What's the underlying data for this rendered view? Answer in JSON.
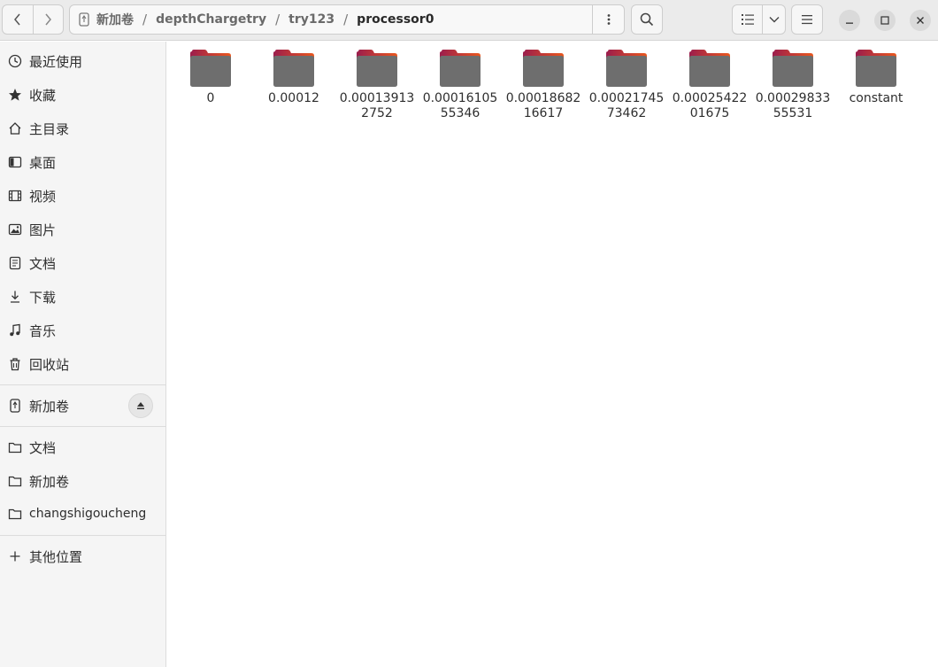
{
  "header": {
    "nav": {
      "back_icon": "chevron-left-icon",
      "forward_icon": "chevron-right-icon"
    },
    "path": [
      {
        "label": "新加卷",
        "icon": "usb-drive-icon"
      },
      {
        "label": "depthChargetry"
      },
      {
        "label": "try123"
      },
      {
        "label": "processor0",
        "current": true
      }
    ],
    "separator": "/",
    "icons": {
      "path_menu": "vertical-dots-icon",
      "search": "search-icon",
      "list_view": "list-view-icon",
      "view_options": "chevron-down-icon",
      "main_menu": "hamburger-menu-icon",
      "minimize": "minimize-icon",
      "maximize": "maximize-icon",
      "close": "close-icon"
    }
  },
  "sidebar": {
    "places": [
      {
        "label": "最近使用",
        "icon": "clock-icon"
      },
      {
        "label": "收藏",
        "icon": "star-icon"
      },
      {
        "label": "主目录",
        "icon": "home-icon"
      },
      {
        "label": "桌面",
        "icon": "desktop-icon"
      },
      {
        "label": "视频",
        "icon": "video-icon"
      },
      {
        "label": "图片",
        "icon": "image-icon"
      },
      {
        "label": "文档",
        "icon": "document-icon"
      },
      {
        "label": "下载",
        "icon": "download-icon"
      },
      {
        "label": "音乐",
        "icon": "music-icon"
      },
      {
        "label": "回收站",
        "icon": "trash-icon"
      }
    ],
    "devices": [
      {
        "label": "新加卷",
        "icon": "usb-drive-icon",
        "action_icon": "eject-icon"
      }
    ],
    "bookmarks": [
      {
        "label": "文档",
        "icon": "folder-icon"
      },
      {
        "label": "新加卷",
        "icon": "folder-icon"
      },
      {
        "label": "changshigoucheng",
        "icon": "folder-icon"
      }
    ],
    "other": {
      "label": "其他位置",
      "icon": "plus-icon"
    }
  },
  "files": [
    {
      "name": "0"
    },
    {
      "name": "0.00012"
    },
    {
      "name": "0.000139132752"
    },
    {
      "name": "0.0001610555346"
    },
    {
      "name": "0.0001868216617"
    },
    {
      "name": "0.0002174573462"
    },
    {
      "name": "0.0002542201675"
    },
    {
      "name": "0.0002983355531"
    },
    {
      "name": "constant"
    }
  ],
  "colors": {
    "folder_body": "#6e6e6e",
    "folder_tab_start": "#9b1d4d",
    "folder_tab_end": "#e9571e"
  }
}
